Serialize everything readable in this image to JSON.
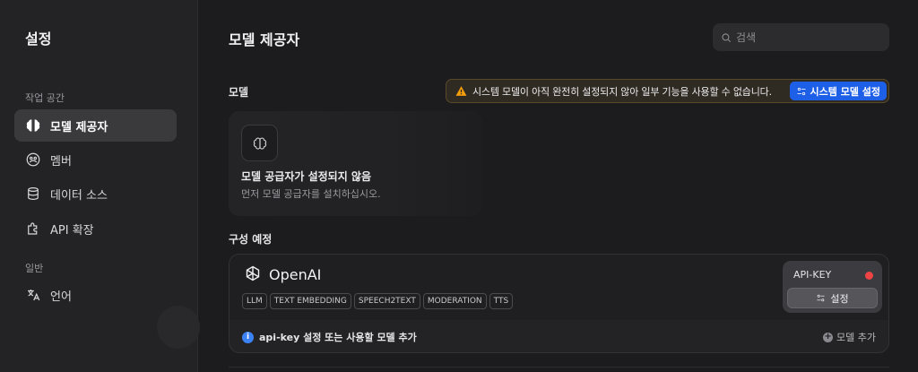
{
  "sidebar": {
    "title": "설정",
    "sections": [
      {
        "label": "작업 공간",
        "items": [
          {
            "label": "모델 제공자",
            "icon": "brain-icon",
            "active": true
          },
          {
            "label": "멤버",
            "icon": "members-icon",
            "active": false
          },
          {
            "label": "데이터 소스",
            "icon": "database-icon",
            "active": false
          },
          {
            "label": "API 확장",
            "icon": "puzzle-icon",
            "active": false
          }
        ]
      },
      {
        "label": "일반",
        "items": [
          {
            "label": "언어",
            "icon": "translate-icon",
            "active": false
          }
        ]
      }
    ]
  },
  "main": {
    "title": "모델 제공자",
    "search": {
      "placeholder": "검색",
      "value": ""
    },
    "models_section": {
      "label": "모델",
      "warning": {
        "text": "시스템 모델이 아직 완전히 설정되지 않아 일부 기능을 사용할 수 없습니다.",
        "button_label": "시스템 모델 설정",
        "icon": "warning-icon"
      },
      "empty": {
        "title": "모델 공급자가 설정되지 않음",
        "subtitle": "먼저 모델 공급자를 설치하십시오."
      }
    },
    "to_configure": {
      "label": "구성 예정",
      "provider": {
        "name": "OpenAI",
        "tags": [
          "LLM",
          "TEXT EMBEDDING",
          "SPEECH2TEXT",
          "MODERATION",
          "TTS"
        ],
        "api_key_label": "API-KEY",
        "status_color": "#ef4444",
        "settings_button": "설정",
        "info_text": "api-key 설정 또는 사용할 모델 추가",
        "add_model_label": "모델 추가"
      }
    }
  },
  "colors": {
    "accent": "#1e5fe8",
    "background": "#1c1c1e",
    "sidebar": "#232325"
  }
}
